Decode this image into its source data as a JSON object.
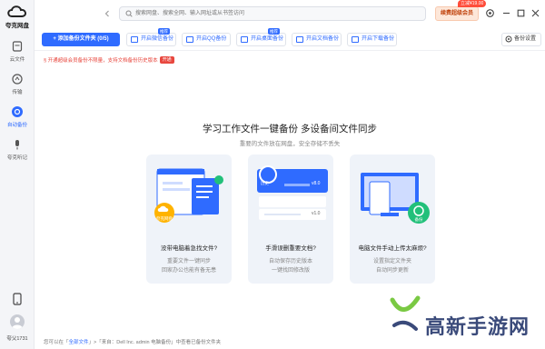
{
  "app": {
    "name": "夸克网盘"
  },
  "sidebar": {
    "items": [
      {
        "label": "云文件",
        "icon": "cloud-file-icon",
        "active": false
      },
      {
        "label": "传输",
        "icon": "transfer-icon",
        "active": false
      },
      {
        "label": "自动备份",
        "icon": "auto-backup-icon",
        "active": true
      },
      {
        "label": "夸克听记",
        "icon": "microphone-icon",
        "active": false
      }
    ],
    "user_id": "夸父1731"
  },
  "topbar": {
    "search_placeholder": "搜索网盘、搜索全网、输入网址或从书签访问",
    "vip_label": "续费超级会员",
    "vip_tag": "立减¥19.00"
  },
  "toolbar": {
    "add_label": "添加备份文件夹 (0/5)",
    "chips": [
      {
        "label": "开启微信备份",
        "tag": "推荐"
      },
      {
        "label": "开启QQ备份",
        "tag": ""
      },
      {
        "label": "开启桌面备份",
        "tag": "推荐"
      },
      {
        "label": "开启文档备份",
        "tag": ""
      },
      {
        "label": "开启下载备份",
        "tag": ""
      }
    ],
    "settings_label": "备份设置"
  },
  "notice": {
    "text": "开通超级会员备份不限量，支持文档备份历史版本",
    "badge": "开通"
  },
  "hero": {
    "title": "学习工作文件一键备份 多设备间文件同步",
    "subtitle": "重要的文件放在网盘，安全存储不丢失"
  },
  "cards": [
    {
      "title": "没带电脑着急找文件?",
      "line1": "重要文件一键同步",
      "line2": "回家办公也能有备无患",
      "art_label": "夸克网盘"
    },
    {
      "title": "手滑误删重要文档?",
      "line1": "自动保存历史版本",
      "line2": "一键找回修改版",
      "art_label": "历史",
      "v1": "v8.0",
      "v2": "v1.0"
    },
    {
      "title": "电脑文件手动上传太麻烦?",
      "line1": "设置指定文件夹",
      "line2": "自动同步更新",
      "art_label": "备份"
    }
  ],
  "footer": {
    "pre": "您可以在「",
    "link1": "全部文件",
    "mid": "」>「来自：Dell Inc. admin 电脑备份」中查看已备份文件夹"
  },
  "watermark": {
    "text": "高新手游网"
  },
  "colors": {
    "accent": "#2f6bff",
    "notice": "#e8473e",
    "vip": "#c1440e"
  }
}
